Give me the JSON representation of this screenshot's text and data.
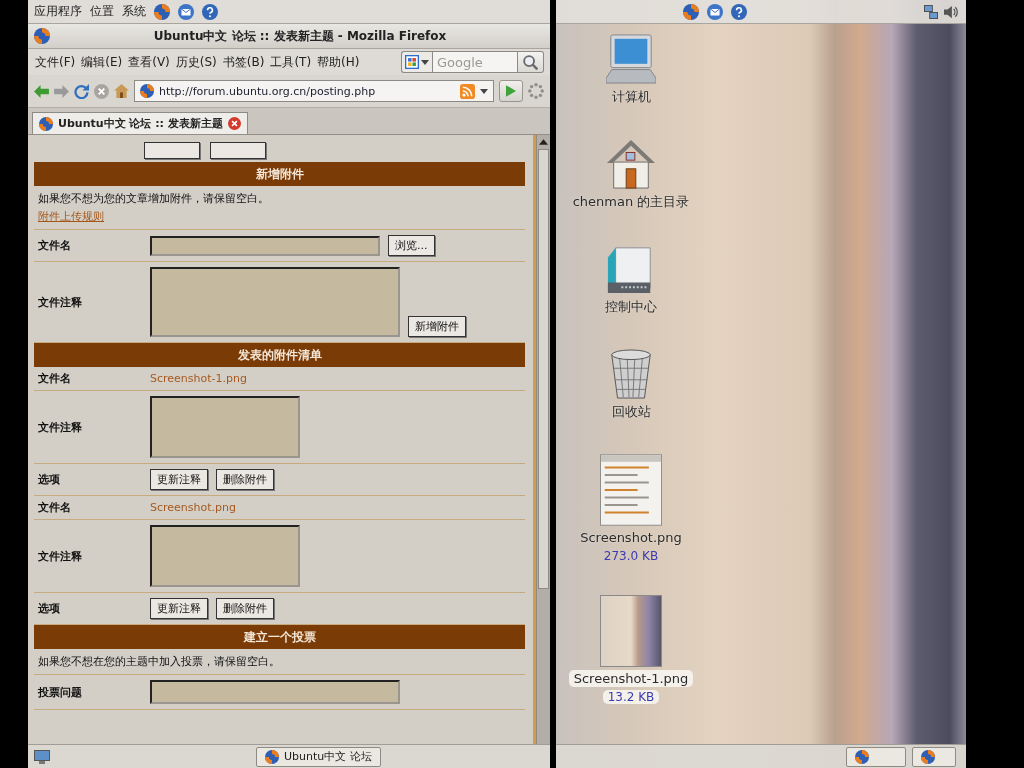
{
  "left_workspace": {
    "top_panel": {
      "menus": [
        "应用程序",
        "位置",
        "系统"
      ]
    },
    "window": {
      "title": "Ubuntu中文 论坛 :: 发表新主题 - Mozilla Firefox",
      "menu": [
        "文件(F)",
        "编辑(E)",
        "查看(V)",
        "历史(S)",
        "书签(B)",
        "工具(T)",
        "帮助(H)"
      ],
      "url": "http://forum.ubuntu.org.cn/posting.php",
      "search": {
        "placeholder": "Google"
      },
      "tabs": [
        {
          "label": "Ubuntu中文 论坛 :: 发表新主题",
          "selected": true
        }
      ],
      "page": {
        "sections": [
          {
            "title": "新增附件",
            "note": "如果您不想为您的文章增加附件，请保留空白。",
            "link": "附件上传规则",
            "rows": [
              {
                "kind": "file",
                "label": "文件名",
                "button": "浏览..."
              },
              {
                "kind": "textarea",
                "label": "文件注释",
                "button": "新增附件"
              }
            ]
          },
          {
            "title": "发表的附件清单",
            "rows": [
              {
                "kind": "filename",
                "label": "文件名",
                "value": "Screenshot-1.png"
              },
              {
                "kind": "textarea",
                "label": "文件注释"
              },
              {
                "kind": "buttons",
                "label": "选项",
                "buttons": [
                  "更新注释",
                  "删除附件"
                ]
              },
              {
                "kind": "filename",
                "label": "文件名",
                "value": "Screenshot.png"
              },
              {
                "kind": "textarea",
                "label": "文件注释"
              },
              {
                "kind": "buttons",
                "label": "选项",
                "buttons": [
                  "更新注释",
                  "删除附件"
                ]
              }
            ]
          },
          {
            "title": "建立一个投票",
            "note": "如果您不想在您的主题中加入投票，请保留空白。",
            "rows": [
              {
                "kind": "input",
                "label": "投票问题"
              }
            ]
          }
        ]
      }
    },
    "taskbar": {
      "tasks": [
        {
          "label": "Ubuntu中文 论坛"
        }
      ]
    }
  },
  "right_workspace": {
    "desktop_icons": [
      {
        "kind": "computer",
        "label": "计算机",
        "selected": false
      },
      {
        "kind": "home",
        "label": "chenman 的主目录",
        "selected": false
      },
      {
        "kind": "control_center",
        "label": "控制中心",
        "selected": false
      },
      {
        "kind": "trash",
        "label": "回收站",
        "selected": false
      },
      {
        "kind": "document_thumbnail",
        "label": "Screenshot.png",
        "size": "273.0 KB",
        "selected": false
      },
      {
        "kind": "photo_thumbnail",
        "label": "Screenshot-1.png",
        "size": "13.2 KB",
        "selected": true
      }
    ]
  }
}
